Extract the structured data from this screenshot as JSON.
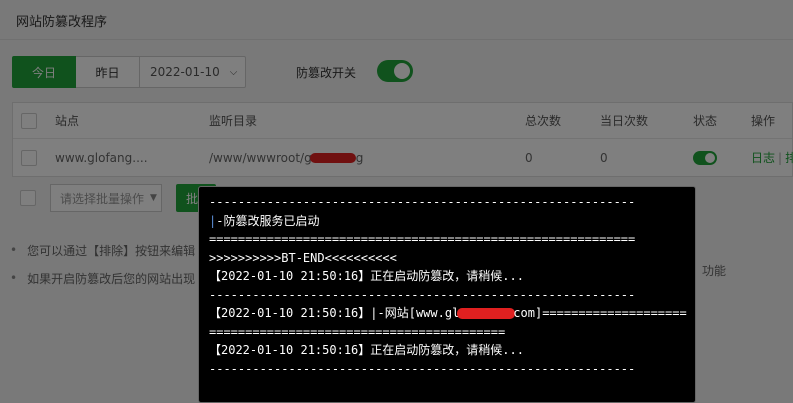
{
  "panel": {
    "title": "网站防篡改程序"
  },
  "toolbar": {
    "today": "今日",
    "yesterday": "昨日",
    "date": "2022-01-10",
    "switch_label": "防篡改开关",
    "switch_on": true
  },
  "table": {
    "headers": [
      "站点",
      "监听目录",
      "总次数",
      "当日次数",
      "状态",
      "操作"
    ],
    "row": {
      "site": "www.glofang....",
      "dir": "/www/wwwroot/g",
      "dir_tail": "g",
      "total": "0",
      "today": "0",
      "status_on": true,
      "op_log": "日志",
      "op_sep": "|",
      "op_more": "排"
    }
  },
  "batch": {
    "placeholder": "请选择批量操作",
    "button": "批"
  },
  "tips": [
    "您可以通过【排除】按钮来编辑",
    "如果开启防篡改后您的网站出现"
  ],
  "tip_tail": "功能",
  "console": {
    "lines": [
      "-----------------------------------------------------------",
      "-防篡改服务已启动",
      "===========================================================",
      ">>>>>>>>>>BT-END<<<<<<<<<<",
      "【2022-01-10 21:50:16】正在启动防篡改，请稍候...",
      "-----------------------------------------------------------",
      "【2022-01-10 21:50:16】|-网站[www.gl",
      "com]====================",
      "=========================================",
      "【2022-01-10 21:50:16】正在启动防篡改，请稍候...",
      "-----------------------------------------------------------"
    ]
  },
  "colors": {
    "accent": "#20a53a",
    "console_bg": "#000000",
    "redaction": "#e02020"
  }
}
